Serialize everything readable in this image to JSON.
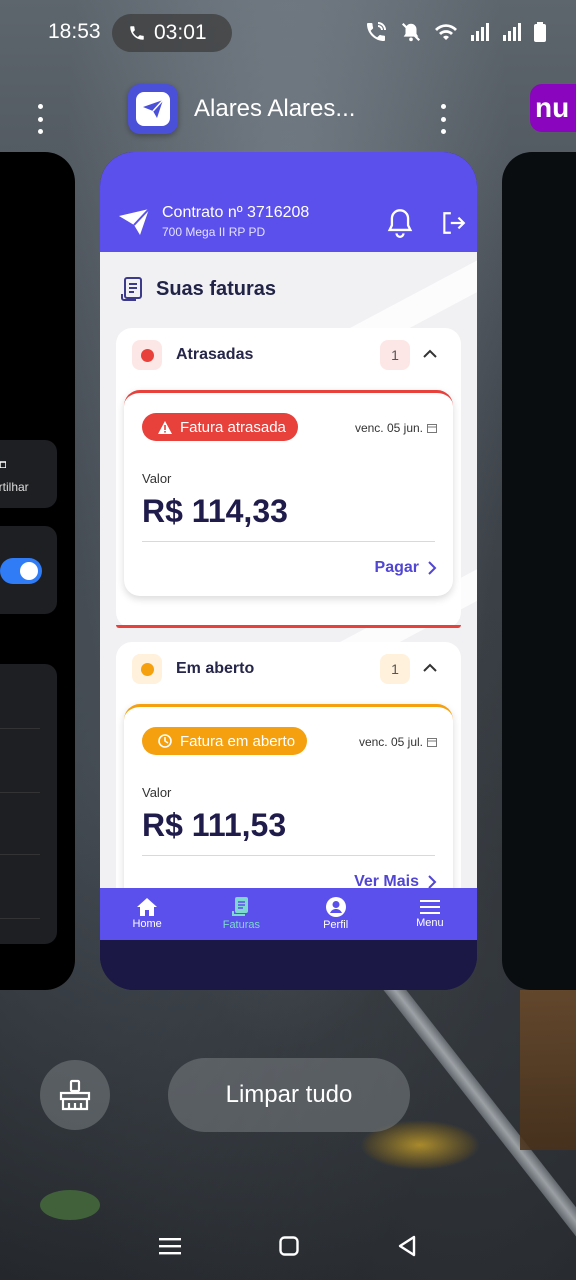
{
  "status_bar": {
    "time": "18:53",
    "call_timer": "03:01"
  },
  "app_switcher": {
    "app_title": "Alares Alares...",
    "right_app_icon_text": "nu",
    "left_card_partial_text": "artilhar",
    "clear_all_label": "Limpar tudo"
  },
  "app": {
    "contract_title": "Contrato nº 3716208",
    "contract_plan": "700 Mega II RP PD",
    "section_title": "Suas faturas",
    "groups": [
      {
        "label": "Atrasadas",
        "count": "1",
        "color": "#e8413c",
        "invoice": {
          "badge": "Fatura atrasada",
          "due": "venc. 05 jun.",
          "value_label": "Valor",
          "value": "R$ 114,33",
          "action": "Pagar"
        }
      },
      {
        "label": "Em aberto",
        "count": "1",
        "color": "#f5a00f",
        "invoice": {
          "badge": "Fatura em aberto",
          "due": "venc. 05 jul.",
          "value_label": "Valor",
          "value": "R$ 111,53",
          "action": "Ver Mais"
        }
      }
    ],
    "nav": [
      {
        "label": "Home",
        "icon": "home-icon"
      },
      {
        "label": "Faturas",
        "icon": "invoice-icon",
        "active": true
      },
      {
        "label": "Perfil",
        "icon": "profile-icon"
      },
      {
        "label": "Menu",
        "icon": "menu-icon"
      }
    ],
    "accent_color": "#5b50ec"
  }
}
